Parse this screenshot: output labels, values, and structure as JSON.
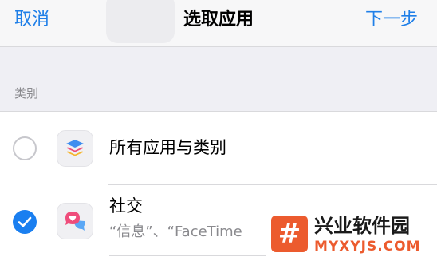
{
  "navbar": {
    "cancel_label": "取消",
    "title": "选取应用",
    "next_label": "下一步"
  },
  "section": {
    "label": "类别"
  },
  "rows": [
    {
      "label": "所有应用与类别",
      "selected": false,
      "icon": "stacked-layers-icon"
    },
    {
      "label": "社交",
      "subtitle": "“信息”、“FaceTime",
      "selected": true,
      "icon": "chat-heart-icon"
    }
  ],
  "watermark": {
    "logo_glyph": "#",
    "title": "兴业软件园",
    "domain": "MYXYJS.COM"
  },
  "colors": {
    "accent": "#1f7fe8",
    "watermark": "#ec5b2e"
  }
}
